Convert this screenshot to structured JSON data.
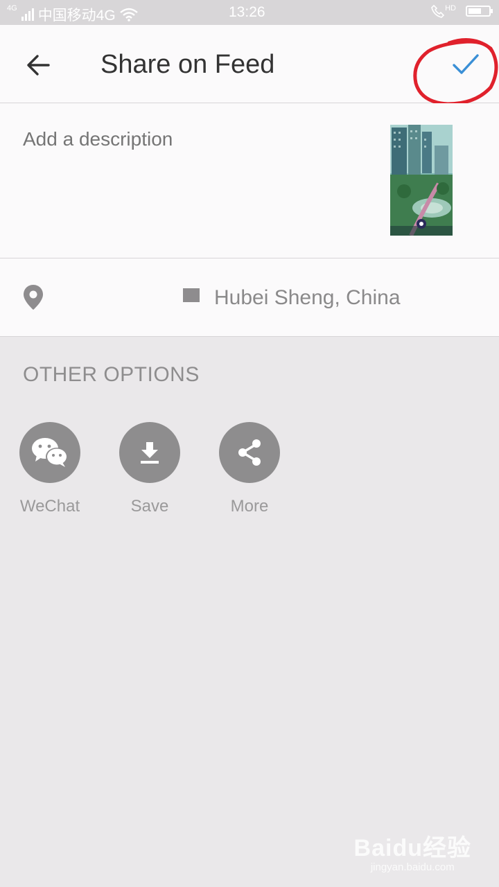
{
  "status_bar": {
    "network": "4G",
    "carrier": "中国移动4G",
    "time": "13:26",
    "call_badge": "HD"
  },
  "header": {
    "title": "Share on Feed",
    "back_icon": "arrow-left-icon",
    "confirm_icon": "check-icon",
    "accent_color": "#3a8fd6",
    "annotation_color": "#e0212c"
  },
  "description": {
    "placeholder": "Add a description",
    "value": ""
  },
  "location": {
    "icon": "map-pin-icon",
    "text": "Hubei Sheng, China"
  },
  "other_options": {
    "title": "OTHER OPTIONS",
    "items": [
      {
        "label": "WeChat",
        "icon": "wechat-icon"
      },
      {
        "label": "Save",
        "icon": "download-icon"
      },
      {
        "label": "More",
        "icon": "share-icon"
      }
    ]
  },
  "watermark": {
    "brand": "Baidu经验",
    "url": "jingyan.baidu.com"
  }
}
